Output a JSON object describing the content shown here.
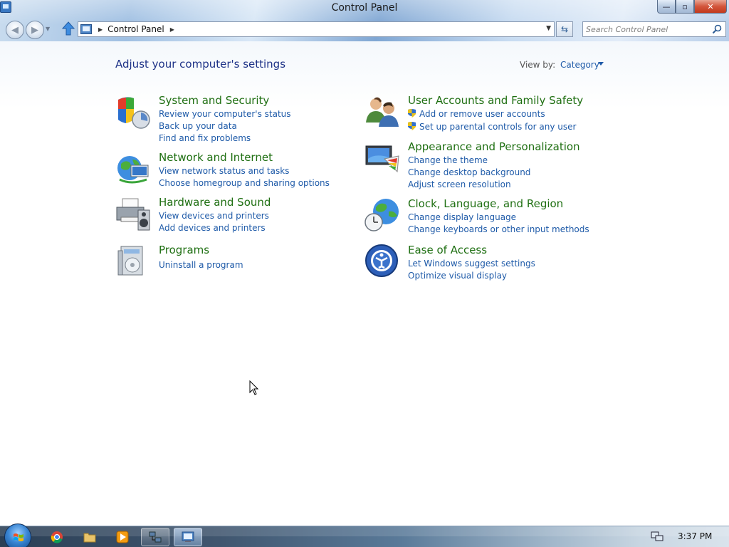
{
  "window": {
    "title": "Control Panel",
    "buttons": {
      "minimize": "—",
      "maximize": "▫",
      "close": "✕"
    }
  },
  "nav": {
    "breadcrumb": "Control Panel",
    "search_placeholder": "Search Control Panel"
  },
  "main": {
    "heading": "Adjust your computer's settings",
    "view_by_label": "View by:",
    "view_by_value": "Category",
    "categories": [
      {
        "icon": "shield-icon",
        "title": "System and Security",
        "links": [
          "Review your computer's status",
          "Back up your data",
          "Find and fix problems"
        ]
      },
      {
        "icon": "globe-network-icon",
        "title": "Network and Internet",
        "links": [
          "View network status and tasks",
          "Choose homegroup and sharing options"
        ]
      },
      {
        "icon": "printer-speaker-icon",
        "title": "Hardware and Sound",
        "links": [
          "View devices and printers",
          "Add devices and printers"
        ]
      },
      {
        "icon": "programs-icon",
        "title": "Programs",
        "links": [
          "Uninstall a program"
        ]
      },
      {
        "icon": "users-icon",
        "title": "User Accounts and Family Safety",
        "links": [
          "Add or remove user accounts",
          "Set up parental controls for any user"
        ]
      },
      {
        "icon": "monitor-palette-icon",
        "title": "Appearance and Personalization",
        "links": [
          "Change the theme",
          "Change desktop background",
          "Adjust screen resolution"
        ]
      },
      {
        "icon": "clock-globe-icon",
        "title": "Clock, Language, and Region",
        "links": [
          "Change display language",
          "Change keyboards or other input methods"
        ]
      },
      {
        "icon": "ease-of-access-icon",
        "title": "Ease of Access",
        "links": [
          "Let Windows suggest settings",
          "Optimize visual display"
        ]
      }
    ]
  },
  "taskbar": {
    "items": [
      "chrome-icon",
      "explorer-folder-icon",
      "media-player-icon",
      "network-app-icon",
      "control-panel-icon"
    ],
    "clock": "3:37 PM"
  },
  "colors": {
    "category_title": "#1f6f12",
    "link": "#1e5aa8",
    "heading": "#1e3287"
  }
}
